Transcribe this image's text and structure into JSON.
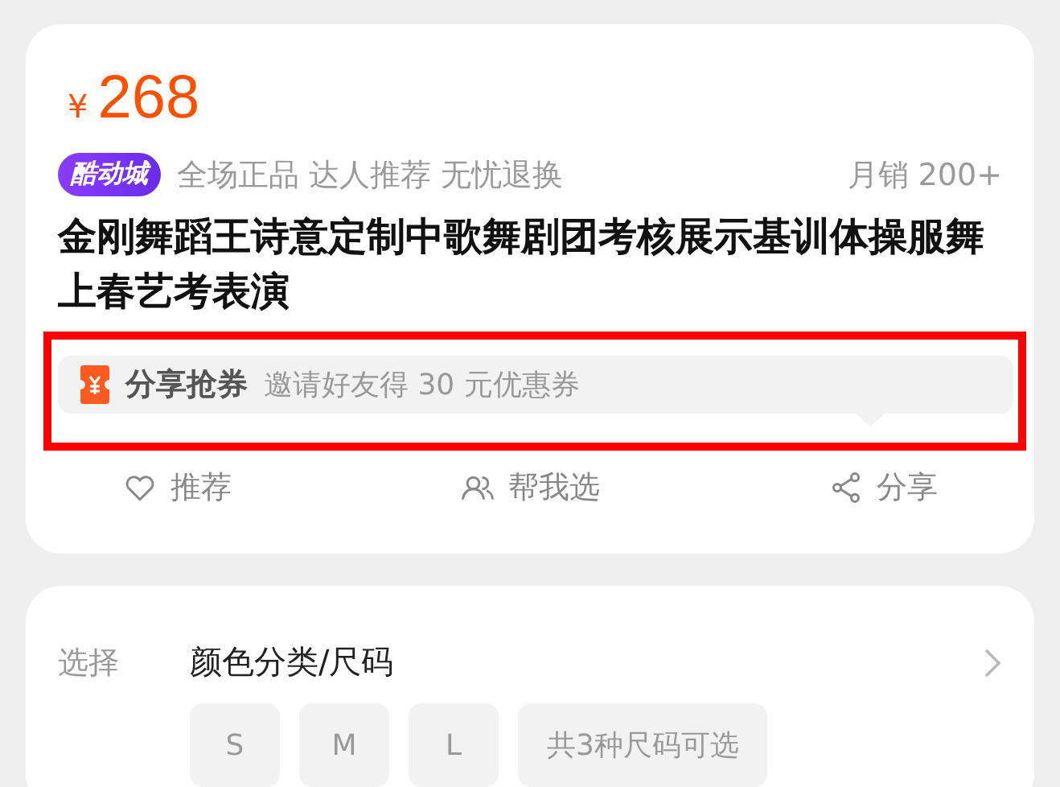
{
  "price": {
    "currency": "¥",
    "amount": "268"
  },
  "badge": "酷动城",
  "tags": "全场正品 达人推荐 无忧退换",
  "monthly_sales": "月销 200+",
  "title": "金刚舞蹈王诗意定制中歌舞剧团考核展示基训体操服舞上春艺考表演",
  "coupon": {
    "label": "分享抢券",
    "text": "邀请好友得 30 元优惠券",
    "highlighted": true
  },
  "actions": [
    {
      "kind": "heart",
      "label": "推荐"
    },
    {
      "kind": "people",
      "label": "帮我选"
    },
    {
      "kind": "share",
      "label": "分享"
    }
  ],
  "selection": {
    "label": "选择",
    "value": "颜色分类/尺码",
    "options": [
      "S",
      "M",
      "L"
    ],
    "summary": "共3种尺码可选"
  }
}
